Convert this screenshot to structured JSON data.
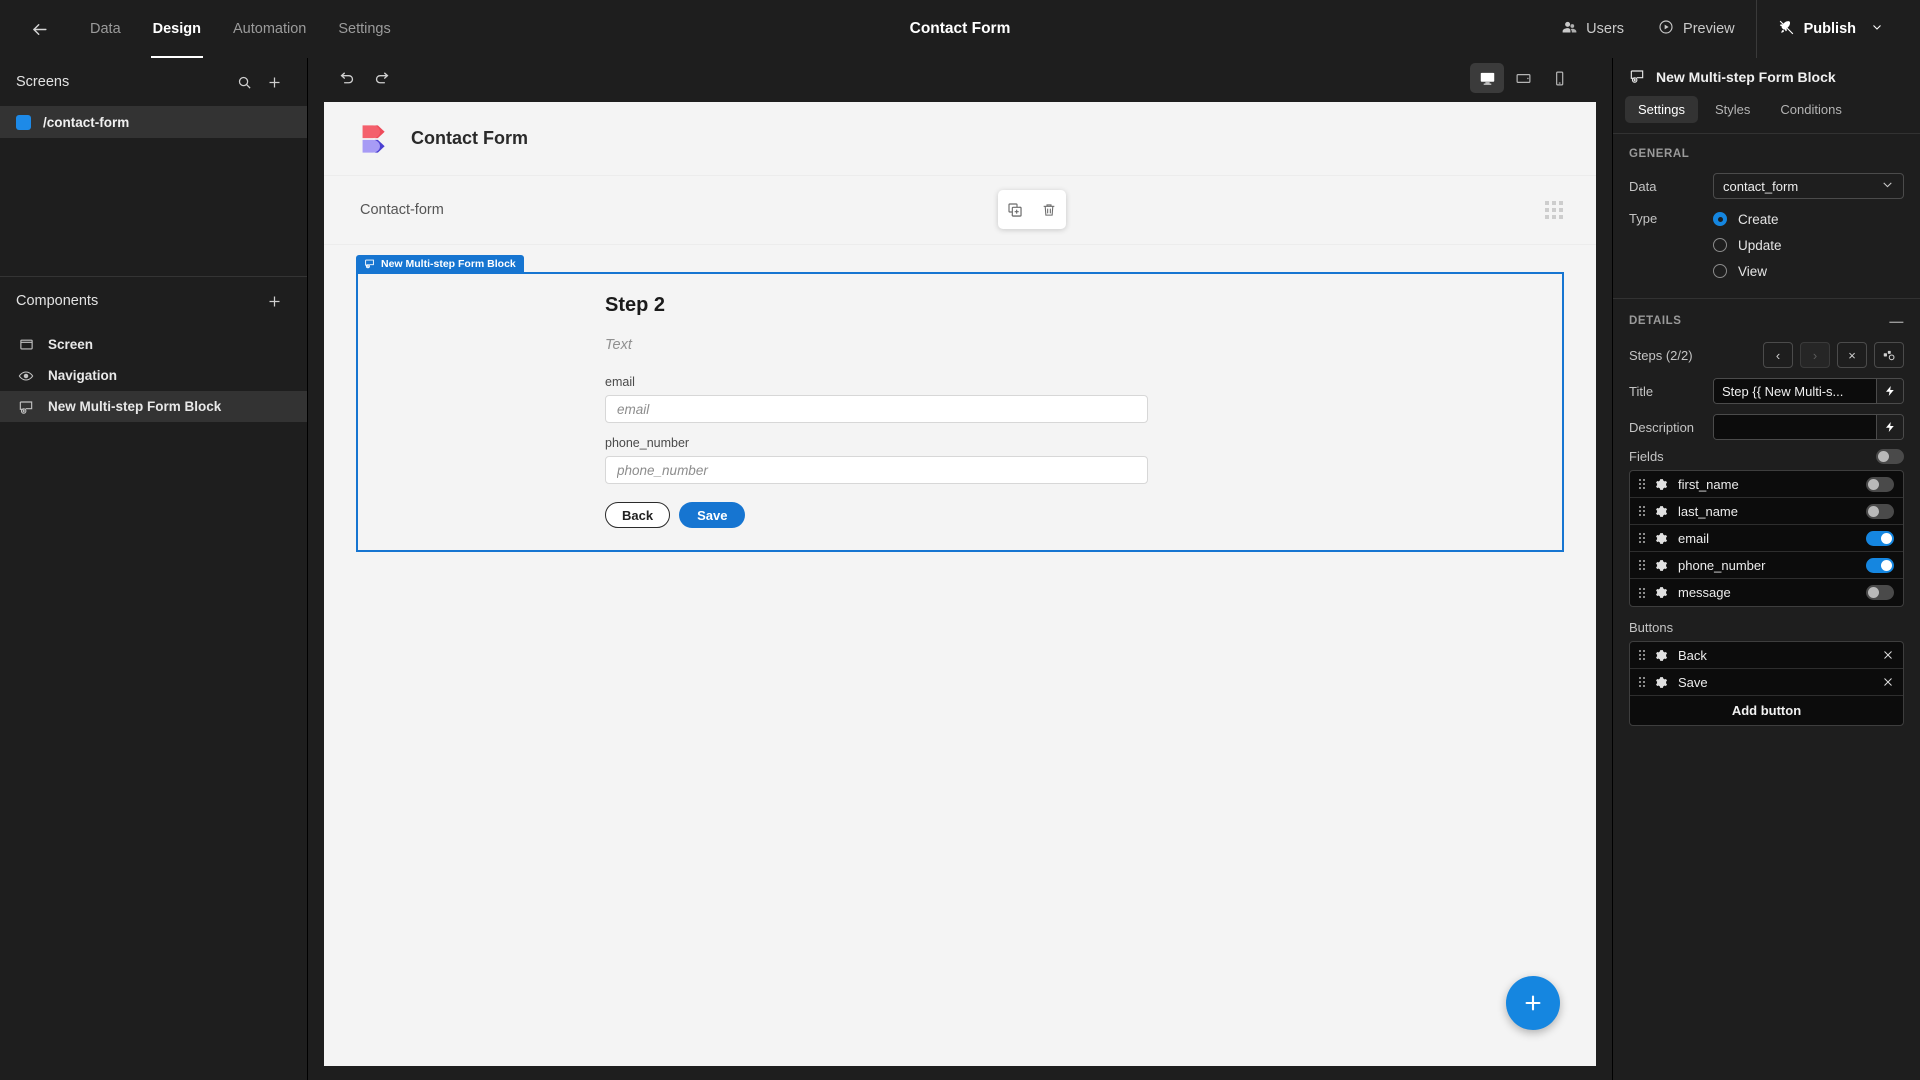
{
  "topbar": {
    "back_icon": "arrow-left-icon",
    "tabs": [
      {
        "label": "Data",
        "active": false
      },
      {
        "label": "Design",
        "active": true
      },
      {
        "label": "Automation",
        "active": false
      },
      {
        "label": "Settings",
        "active": false
      }
    ],
    "title": "Contact Form",
    "users_label": "Users",
    "preview_label": "Preview",
    "publish_label": "Publish"
  },
  "sidebar": {
    "screens_header": "Screens",
    "screens": [
      {
        "label": "/contact-form",
        "selected": true
      }
    ],
    "components_header": "Components",
    "components": [
      {
        "label": "Screen",
        "icon": "screen-icon",
        "selected": false
      },
      {
        "label": "Navigation",
        "icon": "eye-icon",
        "selected": false
      },
      {
        "label": "New Multi-step Form Block",
        "icon": "form-block-icon",
        "selected": true
      }
    ]
  },
  "canvas": {
    "undo_icon": "undo-icon",
    "redo_icon": "redo-icon",
    "devices": [
      {
        "name": "desktop",
        "active": true
      },
      {
        "name": "tablet",
        "active": false
      },
      {
        "name": "mobile",
        "active": false
      }
    ],
    "brand_title": "Contact Form",
    "screen_label": "Contact-form",
    "element_toolbar": {
      "duplicate_icon": "duplicate-icon",
      "delete_icon": "trash-icon"
    },
    "block_badge": "New Multi-step Form Block",
    "form": {
      "step_title": "Step 2",
      "description": "Text",
      "fields": [
        {
          "label": "email",
          "placeholder": "email",
          "value": ""
        },
        {
          "label": "phone_number",
          "placeholder": "phone_number",
          "value": ""
        }
      ],
      "buttons": [
        {
          "label": "Back",
          "style": "outline"
        },
        {
          "label": "Save",
          "style": "primary"
        }
      ]
    },
    "fab_label": "+"
  },
  "rightpanel": {
    "title": "New Multi-step Form Block",
    "tabs": [
      {
        "label": "Settings",
        "active": true
      },
      {
        "label": "Styles",
        "active": false
      },
      {
        "label": "Conditions",
        "active": false
      }
    ],
    "general_header": "GENERAL",
    "data_label": "Data",
    "data_value": "contact_form",
    "type_label": "Type",
    "type_options": [
      {
        "label": "Create",
        "selected": true
      },
      {
        "label": "Update",
        "selected": false
      },
      {
        "label": "View",
        "selected": false
      }
    ],
    "details_header": "DETAILS",
    "steps_label": "Steps (2/2)",
    "steps_buttons": [
      {
        "name": "prev-step",
        "glyph": "‹",
        "disabled": false
      },
      {
        "name": "next-step",
        "glyph": "›",
        "disabled": true
      },
      {
        "name": "delete-step",
        "glyph": "×",
        "disabled": false
      },
      {
        "name": "step-flow",
        "glyph": "",
        "disabled": false
      }
    ],
    "title_label": "Title",
    "title_value": "Step {{ New Multi-s...",
    "description_label": "Description",
    "description_value": "",
    "fields_label": "Fields",
    "fields_master_toggle": false,
    "fields": [
      {
        "label": "first_name",
        "enabled": false
      },
      {
        "label": "last_name",
        "enabled": false
      },
      {
        "label": "email",
        "enabled": true
      },
      {
        "label": "phone_number",
        "enabled": true
      },
      {
        "label": "message",
        "enabled": false
      }
    ],
    "buttons_label": "Buttons",
    "buttons": [
      {
        "label": "Back"
      },
      {
        "label": "Save"
      }
    ],
    "add_button_label": "Add button"
  },
  "colors": {
    "accent": "#1586e0",
    "block_outline": "#1675d1",
    "panel_bg": "#1e1e1e",
    "canvas_bg": "#f4f4f4"
  }
}
